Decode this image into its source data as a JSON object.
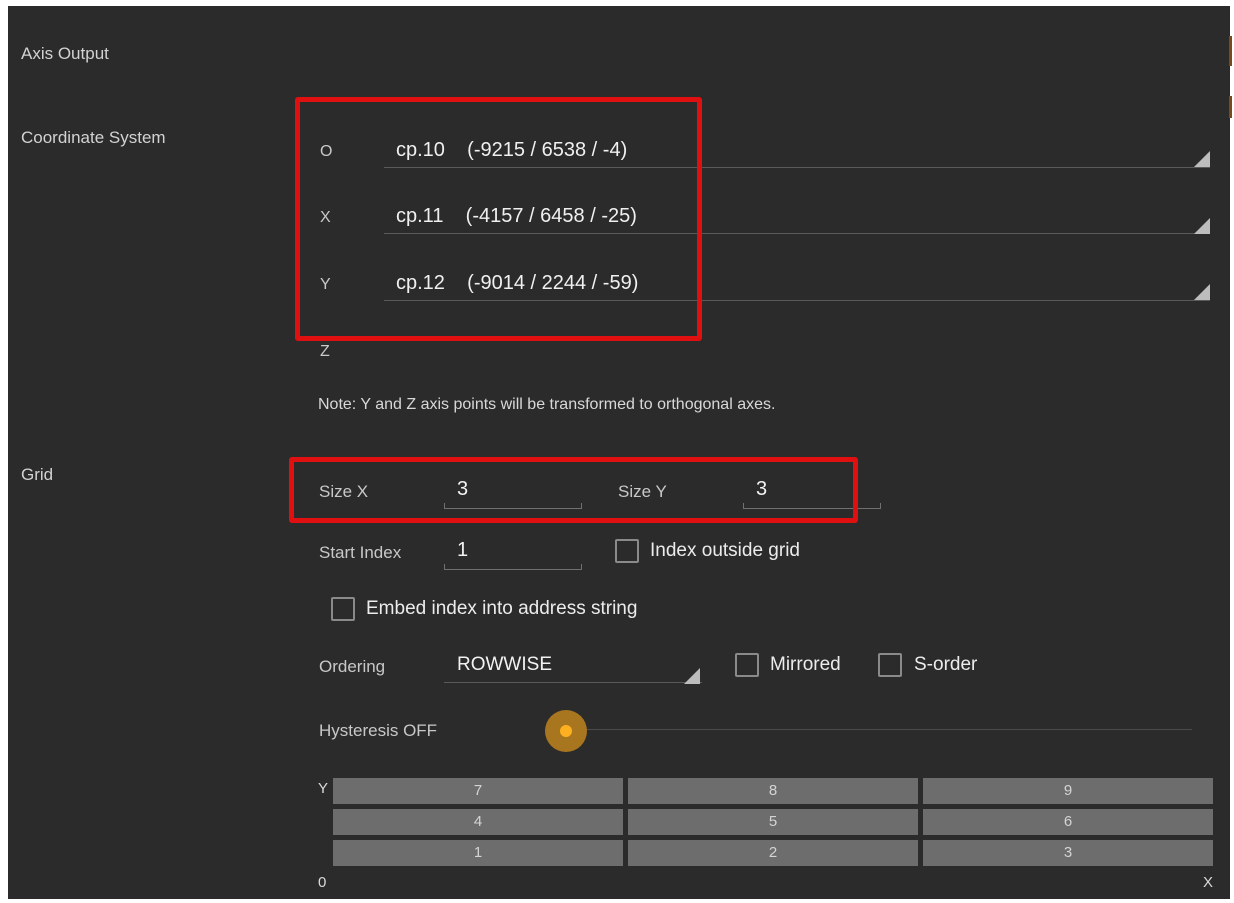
{
  "sections": {
    "axis_output": "Axis Output",
    "coordinate_system": "Coordinate System",
    "grid": "Grid"
  },
  "coordinate_rows": [
    {
      "letter": "O",
      "value": "cp.10    (-9215 / 6538 / -4)"
    },
    {
      "letter": "X",
      "value": "cp.11    (-4157 / 6458 / -25)"
    },
    {
      "letter": "Y",
      "value": "cp.12    (-9014 / 2244 / -59)"
    }
  ],
  "z_label": "Z",
  "note": "Note: Y and Z axis points will be transformed to orthogonal axes.",
  "grid": {
    "size_x_label": "Size X",
    "size_x_value": "3",
    "size_y_label": "Size Y",
    "size_y_value": "3",
    "start_index_label": "Start Index",
    "start_index_value": "1",
    "index_outside_grid_label": "Index outside grid",
    "index_outside_grid_checked": false,
    "embed_index_label": "Embed index into address string",
    "embed_index_checked": false,
    "ordering_label": "Ordering",
    "ordering_value": "ROWWISE",
    "mirrored_label": "Mirrored",
    "mirrored_checked": false,
    "s_order_label": "S-order",
    "s_order_checked": false,
    "hysteresis_label": "Hysteresis OFF",
    "hysteresis_level": 0
  },
  "grid_preview": {
    "y_axis": "Y",
    "x_axis": "X",
    "origin": "0",
    "rows": [
      [
        "7",
        "8",
        "9"
      ],
      [
        "4",
        "5",
        "6"
      ],
      [
        "1",
        "2",
        "3"
      ]
    ]
  },
  "colors": {
    "panel_bg": "#2b2b2b",
    "highlight": "#e01010",
    "slider_accent": "#ffb020"
  }
}
